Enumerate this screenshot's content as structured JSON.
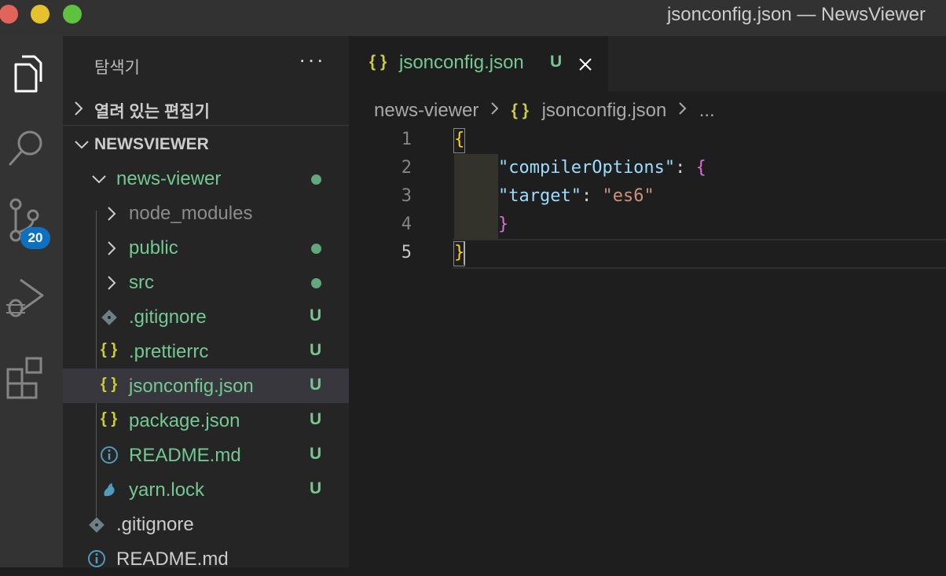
{
  "window": {
    "title": "jsonconfig.json — NewsViewer"
  },
  "activity_bar": {
    "items": [
      {
        "name": "explorer-icon"
      },
      {
        "name": "search-icon"
      },
      {
        "name": "source-control-icon",
        "badge": "20"
      },
      {
        "name": "run-debug-icon"
      },
      {
        "name": "extensions-icon"
      }
    ]
  },
  "sidebar": {
    "title": "탐색기",
    "more": "···",
    "open_editors": "열려 있는 편집기",
    "workspace": "NEWSVIEWER",
    "tree": [
      {
        "label": "news-viewer",
        "status": "dot"
      },
      {
        "label": "node_modules"
      },
      {
        "label": "public",
        "status": "dot"
      },
      {
        "label": "src",
        "status": "dot"
      },
      {
        "label": ".gitignore",
        "status": "U"
      },
      {
        "label": ".prettierrc",
        "icon": "{ }",
        "status": "U"
      },
      {
        "label": "jsonconfig.json",
        "icon": "{ }",
        "status": "U"
      },
      {
        "label": "package.json",
        "icon": "{ }",
        "status": "U"
      },
      {
        "label": "README.md",
        "status": "U"
      },
      {
        "label": "yarn.lock",
        "status": "U"
      },
      {
        "label": ".gitignore"
      },
      {
        "label": "README.md"
      }
    ]
  },
  "tab": {
    "icon": "{ }",
    "label": "jsonconfig.json",
    "status": "U"
  },
  "breadcrumb": {
    "folder": "news-viewer",
    "icon": "{ }",
    "file": "jsonconfig.json",
    "more": "..."
  },
  "editor": {
    "line_numbers": [
      "1",
      "2",
      "3",
      "4",
      "5"
    ],
    "tokens": {
      "open_brace": "{",
      "key1": "\"compilerOptions\"",
      "colon": ":",
      "inner_open": "{",
      "key2": "\"target\"",
      "value2": "\"es6\"",
      "inner_close": "}",
      "close_brace": "}"
    }
  },
  "colors": {
    "accent_green": "#73c991",
    "json_icon": "#cbcb41",
    "badge_blue": "#0e70c0"
  }
}
